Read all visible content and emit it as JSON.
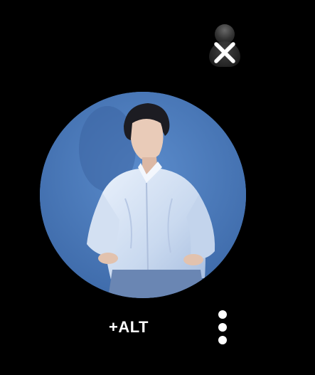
{
  "viewer": {
    "alt_button_label": "+ALT",
    "close_icon": "close-icon",
    "more_icon": "more-vertical-icon"
  },
  "colors": {
    "background": "#000000",
    "photo_backdrop": "#4a78b8",
    "controls": "#ffffff"
  }
}
